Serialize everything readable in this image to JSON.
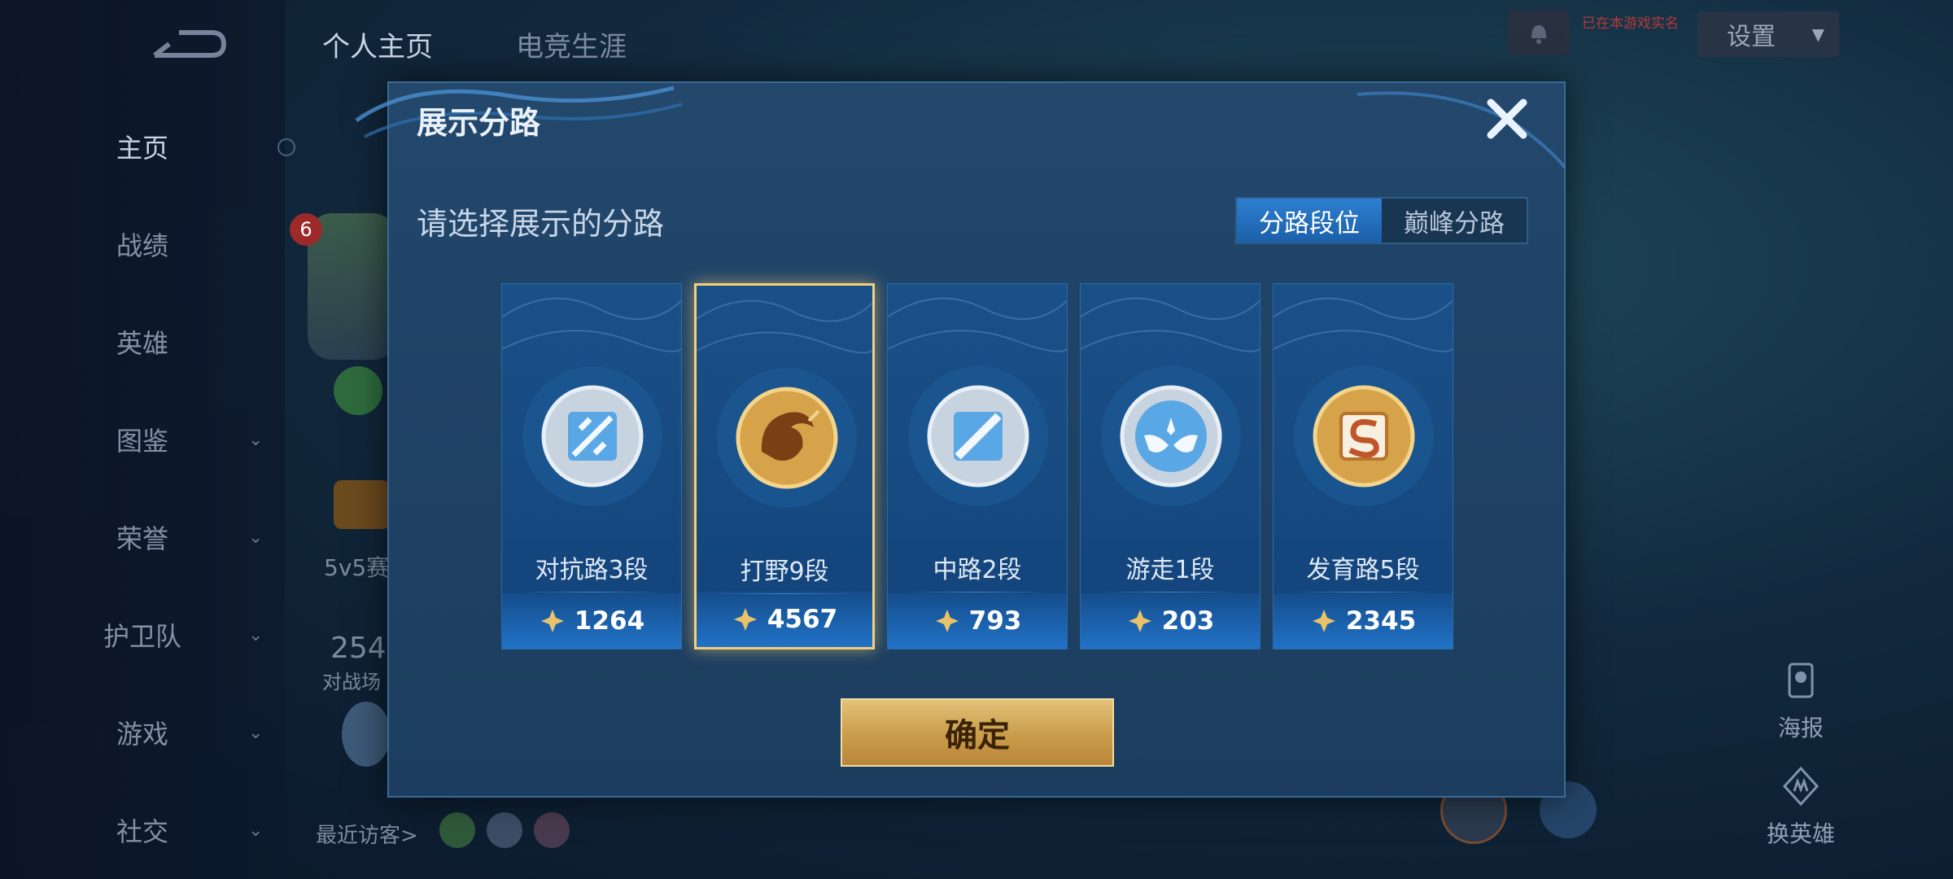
{
  "background": {
    "sidebar": {
      "items": [
        {
          "label": "主页",
          "has_chevron": false
        },
        {
          "label": "战绩",
          "has_chevron": false
        },
        {
          "label": "英雄",
          "has_chevron": false
        },
        {
          "label": "图鉴",
          "has_chevron": true
        },
        {
          "label": "荣誉",
          "has_chevron": true
        },
        {
          "label": "护卫队",
          "has_chevron": true
        },
        {
          "label": "游戏",
          "has_chevron": true
        },
        {
          "label": "社交",
          "has_chevron": true
        }
      ]
    },
    "tabs": [
      {
        "label": "个人主页"
      },
      {
        "label": "电竞生涯"
      }
    ],
    "settings_label": "设置",
    "notice_text": "已在本游戏实名",
    "level_badge": "6",
    "mode_text": "5v5赛",
    "number_text": "254",
    "battle_text": "对战场",
    "recent_visitors_label": "最近访客>",
    "right_buttons": [
      {
        "label": "海报",
        "icon": "poster-icon"
      },
      {
        "label": "换英雄",
        "icon": "swap-hero-icon"
      }
    ]
  },
  "modal": {
    "title": "展示分路",
    "subtitle": "请选择展示的分路",
    "toggle": {
      "options": [
        "分路段位",
        "巅峰分路"
      ],
      "selected": "分路段位"
    },
    "lanes": [
      {
        "label": "对抗路3段",
        "score": "1264",
        "icon": "clash-lane-emblem",
        "tier": "silver"
      },
      {
        "label": "打野9段",
        "score": "4567",
        "icon": "jungle-dragon-emblem",
        "tier": "gold"
      },
      {
        "label": "中路2段",
        "score": "793",
        "icon": "mid-lane-emblem",
        "tier": "silver"
      },
      {
        "label": "游走1段",
        "score": "203",
        "icon": "roam-wings-emblem",
        "tier": "silver"
      },
      {
        "label": "发育路5段",
        "score": "2345",
        "icon": "farm-lane-emblem",
        "tier": "gold"
      }
    ],
    "selected_lane": "打野9段",
    "confirm_label": "确定"
  },
  "colors": {
    "accent_gold": "#f3cf7a",
    "toggle_active": "#2d7fd0",
    "card_blue": "#164a80"
  }
}
